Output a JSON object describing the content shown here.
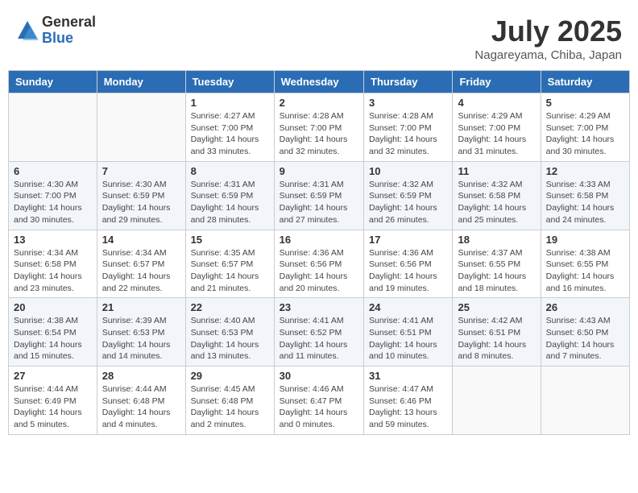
{
  "header": {
    "logo_general": "General",
    "logo_blue": "Blue",
    "month_title": "July 2025",
    "location": "Nagareyama, Chiba, Japan"
  },
  "weekdays": [
    "Sunday",
    "Monday",
    "Tuesday",
    "Wednesday",
    "Thursday",
    "Friday",
    "Saturday"
  ],
  "weeks": [
    [
      {
        "day": "",
        "info": ""
      },
      {
        "day": "",
        "info": ""
      },
      {
        "day": "1",
        "info": "Sunrise: 4:27 AM\nSunset: 7:00 PM\nDaylight: 14 hours\nand 33 minutes."
      },
      {
        "day": "2",
        "info": "Sunrise: 4:28 AM\nSunset: 7:00 PM\nDaylight: 14 hours\nand 32 minutes."
      },
      {
        "day": "3",
        "info": "Sunrise: 4:28 AM\nSunset: 7:00 PM\nDaylight: 14 hours\nand 32 minutes."
      },
      {
        "day": "4",
        "info": "Sunrise: 4:29 AM\nSunset: 7:00 PM\nDaylight: 14 hours\nand 31 minutes."
      },
      {
        "day": "5",
        "info": "Sunrise: 4:29 AM\nSunset: 7:00 PM\nDaylight: 14 hours\nand 30 minutes."
      }
    ],
    [
      {
        "day": "6",
        "info": "Sunrise: 4:30 AM\nSunset: 7:00 PM\nDaylight: 14 hours\nand 30 minutes."
      },
      {
        "day": "7",
        "info": "Sunrise: 4:30 AM\nSunset: 6:59 PM\nDaylight: 14 hours\nand 29 minutes."
      },
      {
        "day": "8",
        "info": "Sunrise: 4:31 AM\nSunset: 6:59 PM\nDaylight: 14 hours\nand 28 minutes."
      },
      {
        "day": "9",
        "info": "Sunrise: 4:31 AM\nSunset: 6:59 PM\nDaylight: 14 hours\nand 27 minutes."
      },
      {
        "day": "10",
        "info": "Sunrise: 4:32 AM\nSunset: 6:59 PM\nDaylight: 14 hours\nand 26 minutes."
      },
      {
        "day": "11",
        "info": "Sunrise: 4:32 AM\nSunset: 6:58 PM\nDaylight: 14 hours\nand 25 minutes."
      },
      {
        "day": "12",
        "info": "Sunrise: 4:33 AM\nSunset: 6:58 PM\nDaylight: 14 hours\nand 24 minutes."
      }
    ],
    [
      {
        "day": "13",
        "info": "Sunrise: 4:34 AM\nSunset: 6:58 PM\nDaylight: 14 hours\nand 23 minutes."
      },
      {
        "day": "14",
        "info": "Sunrise: 4:34 AM\nSunset: 6:57 PM\nDaylight: 14 hours\nand 22 minutes."
      },
      {
        "day": "15",
        "info": "Sunrise: 4:35 AM\nSunset: 6:57 PM\nDaylight: 14 hours\nand 21 minutes."
      },
      {
        "day": "16",
        "info": "Sunrise: 4:36 AM\nSunset: 6:56 PM\nDaylight: 14 hours\nand 20 minutes."
      },
      {
        "day": "17",
        "info": "Sunrise: 4:36 AM\nSunset: 6:56 PM\nDaylight: 14 hours\nand 19 minutes."
      },
      {
        "day": "18",
        "info": "Sunrise: 4:37 AM\nSunset: 6:55 PM\nDaylight: 14 hours\nand 18 minutes."
      },
      {
        "day": "19",
        "info": "Sunrise: 4:38 AM\nSunset: 6:55 PM\nDaylight: 14 hours\nand 16 minutes."
      }
    ],
    [
      {
        "day": "20",
        "info": "Sunrise: 4:38 AM\nSunset: 6:54 PM\nDaylight: 14 hours\nand 15 minutes."
      },
      {
        "day": "21",
        "info": "Sunrise: 4:39 AM\nSunset: 6:53 PM\nDaylight: 14 hours\nand 14 minutes."
      },
      {
        "day": "22",
        "info": "Sunrise: 4:40 AM\nSunset: 6:53 PM\nDaylight: 14 hours\nand 13 minutes."
      },
      {
        "day": "23",
        "info": "Sunrise: 4:41 AM\nSunset: 6:52 PM\nDaylight: 14 hours\nand 11 minutes."
      },
      {
        "day": "24",
        "info": "Sunrise: 4:41 AM\nSunset: 6:51 PM\nDaylight: 14 hours\nand 10 minutes."
      },
      {
        "day": "25",
        "info": "Sunrise: 4:42 AM\nSunset: 6:51 PM\nDaylight: 14 hours\nand 8 minutes."
      },
      {
        "day": "26",
        "info": "Sunrise: 4:43 AM\nSunset: 6:50 PM\nDaylight: 14 hours\nand 7 minutes."
      }
    ],
    [
      {
        "day": "27",
        "info": "Sunrise: 4:44 AM\nSunset: 6:49 PM\nDaylight: 14 hours\nand 5 minutes."
      },
      {
        "day": "28",
        "info": "Sunrise: 4:44 AM\nSunset: 6:48 PM\nDaylight: 14 hours\nand 4 minutes."
      },
      {
        "day": "29",
        "info": "Sunrise: 4:45 AM\nSunset: 6:48 PM\nDaylight: 14 hours\nand 2 minutes."
      },
      {
        "day": "30",
        "info": "Sunrise: 4:46 AM\nSunset: 6:47 PM\nDaylight: 14 hours\nand 0 minutes."
      },
      {
        "day": "31",
        "info": "Sunrise: 4:47 AM\nSunset: 6:46 PM\nDaylight: 13 hours\nand 59 minutes."
      },
      {
        "day": "",
        "info": ""
      },
      {
        "day": "",
        "info": ""
      }
    ]
  ]
}
